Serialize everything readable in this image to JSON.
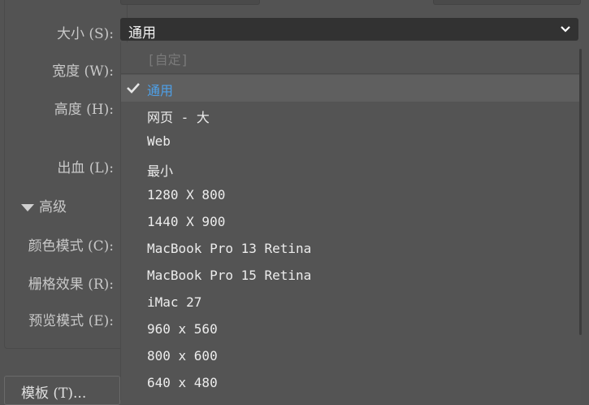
{
  "labels": {
    "size": "大小 (S):",
    "width": "宽度 (W):",
    "height": "高度 (H):",
    "bleed": "出血 (L):",
    "advanced": "高级",
    "color_mode": "颜色模式 (C):",
    "raster_effects": "栅格效果 (R):",
    "preview_mode": "预览模式 (E):"
  },
  "size_select": {
    "value": "通用",
    "options": [
      {
        "label": "[自定]",
        "state": "disabled"
      },
      {
        "label": "通用",
        "state": "selected"
      },
      {
        "label": "网页 - 大",
        "state": "normal"
      },
      {
        "label": "Web",
        "state": "normal"
      },
      {
        "label": "最小",
        "state": "normal"
      },
      {
        "label": "1280 X 800",
        "state": "normal"
      },
      {
        "label": "1440 X 900",
        "state": "normal"
      },
      {
        "label": "MacBook Pro 13 Retina",
        "state": "normal"
      },
      {
        "label": "MacBook Pro 15 Retina",
        "state": "normal"
      },
      {
        "label": "iMac 27",
        "state": "normal"
      },
      {
        "label": "960 x 560",
        "state": "normal"
      },
      {
        "label": "800 x 600",
        "state": "normal"
      },
      {
        "label": "640 x 480",
        "state": "normal"
      }
    ]
  },
  "template_button": "模板 (T)...",
  "colors": {
    "accent": "#4ea0e8",
    "background": "#535353",
    "select_bg": "#323232"
  }
}
